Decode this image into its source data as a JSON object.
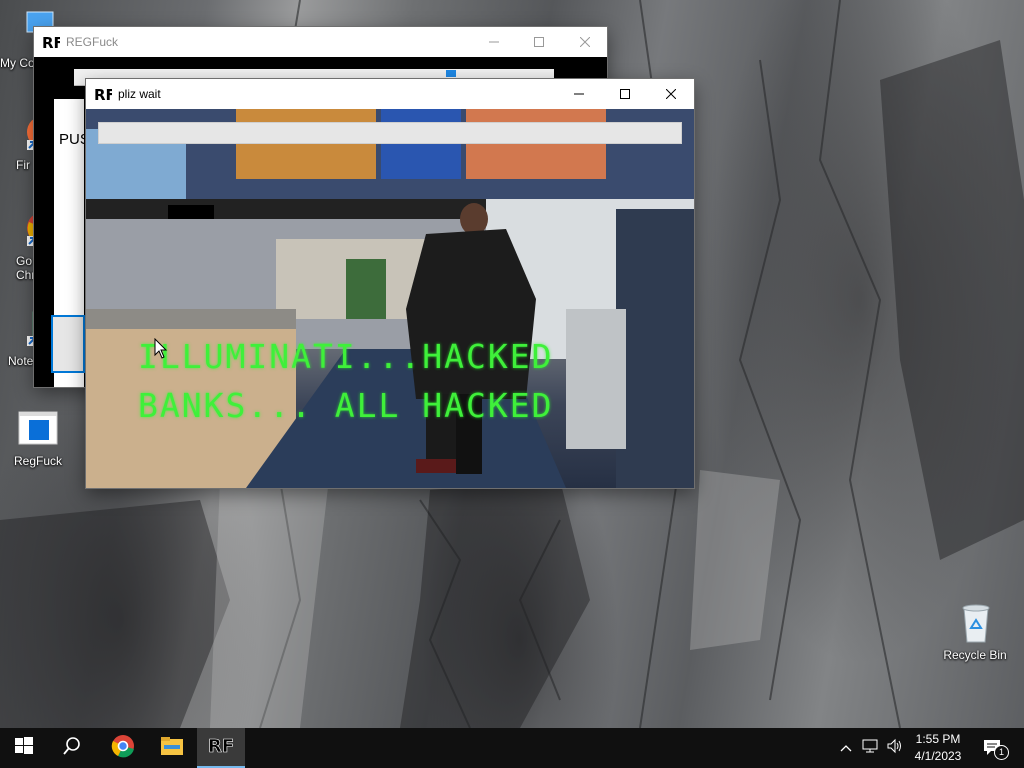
{
  "desktop": {
    "icons": [
      {
        "label": "My Co",
        "icon": "my-computer-icon"
      },
      {
        "label": "Fir",
        "icon": "firefox-icon"
      },
      {
        "label": "Go\nChr",
        "icon": "chrome-icon"
      },
      {
        "label": "Note",
        "icon": "notepad-icon"
      },
      {
        "label": "RegFuck",
        "icon": "regfuck-app-icon"
      },
      {
        "label": "Recycle Bin",
        "icon": "recycle-bin-icon"
      }
    ]
  },
  "windows": {
    "regfuck": {
      "title": "REGFuck",
      "push_text": "PUS"
    },
    "pliz_wait": {
      "title": "pliz wait",
      "progress": 0,
      "overlay_line1": "ILLUMINATI...HACKED",
      "overlay_line2": "BANKS... ALL HACKED"
    }
  },
  "taskbar": {
    "pinned": [
      "start-icon",
      "search-icon",
      "chrome-icon",
      "file-explorer-icon",
      "regfuck-app-icon"
    ],
    "active_app": "regfuck-app-icon",
    "time": "1:55 PM",
    "date": "4/1/2023",
    "notification_count": "1"
  },
  "colors": {
    "accent": "#0078d7",
    "hack_text": "#3ff03a",
    "taskbar": "#101010"
  }
}
